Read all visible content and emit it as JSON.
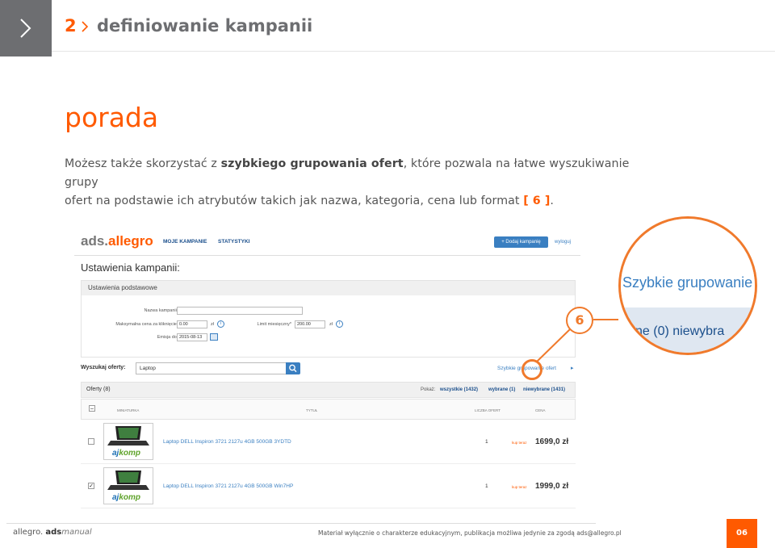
{
  "header": {
    "step": "2",
    "title": "definiowanie kampanii"
  },
  "tip": {
    "heading": "porada",
    "line1_a": "Możesz także skorzystać z ",
    "line1_bold": "szybkiego grupowania ofert",
    "line1_b": ", które pozwala na łatwe wyszukiwanie grupy",
    "line2_a": "ofert na podstawie ich atrybutów takich jak nazwa, kategoria, cena lub format ",
    "line2_ref": "[ 6 ]",
    "line2_end": "."
  },
  "screenshot": {
    "logo_prefix": "ads.",
    "logo_brand": "allegro",
    "nav": [
      "MOJE KAMPANIE",
      "STATYSTYKI"
    ],
    "add_campaign": "+ Dodaj kampanię",
    "logout": "wyloguj",
    "settings_title": "Ustawienia kampanii:",
    "basic_settings": "Ustawienia podstawowe",
    "fields": {
      "name_label": "Nazwa kampanii*",
      "name_value": "",
      "max_price_label": "Maksymalna cena za kliknięcie*",
      "max_price_value": "0.00",
      "max_price_unit": "zł",
      "monthly_limit_label": "Limit miesięczny*",
      "monthly_limit_value": "200.00",
      "monthly_limit_unit": "zł",
      "emission_label": "Emisja do*",
      "emission_value": "2015-08-13"
    },
    "search_label": "Wyszukaj oferty:",
    "search_value": "Laptop",
    "fast_grouping": "Szybkie grupowanie ofert",
    "offers_title": "Oferty (8)",
    "show_label": "Pokaż:",
    "filters": [
      "wszystkie (1432)",
      "wybrane (1)",
      "niewybrane (1431)"
    ],
    "columns": [
      "MINIATURKA",
      "TYTUŁ",
      "LICZBA OFERT",
      "CENA"
    ],
    "rows": [
      {
        "checked": "",
        "title": "Laptop DELL Inspiron 3721 2127u 4GB 500GB 3YDTD",
        "count": "1",
        "buy": "kup teraz",
        "price": "1699,0 zł",
        "brand_a": "aj",
        "brand_b": "komp"
      },
      {
        "checked": "✓",
        "title": "Laptop DELL Inspiron 3721 2127u 4GB 500GB Win7HP",
        "count": "1",
        "buy": "kup teraz",
        "price": "1999,0 zł",
        "brand_a": "aj",
        "brand_b": "komp"
      }
    ]
  },
  "zoom": {
    "fast": "Szybkie grupowanie",
    "tabs": "ne (0)    niewybra",
    "marker": "6"
  },
  "footer": {
    "logo_a": "allegro.",
    "logo_b": "ads",
    "logo_c": "manual",
    "note": "Materiał wyłącznie o charakterze edukacyjnym, publikacja możliwa jedynie za zgodą ads@allegro.pl",
    "page": "06"
  },
  "colors": {
    "accent": "#ff5a00",
    "header_grey": "#6d6e71",
    "link_blue": "#3a7fc1"
  }
}
